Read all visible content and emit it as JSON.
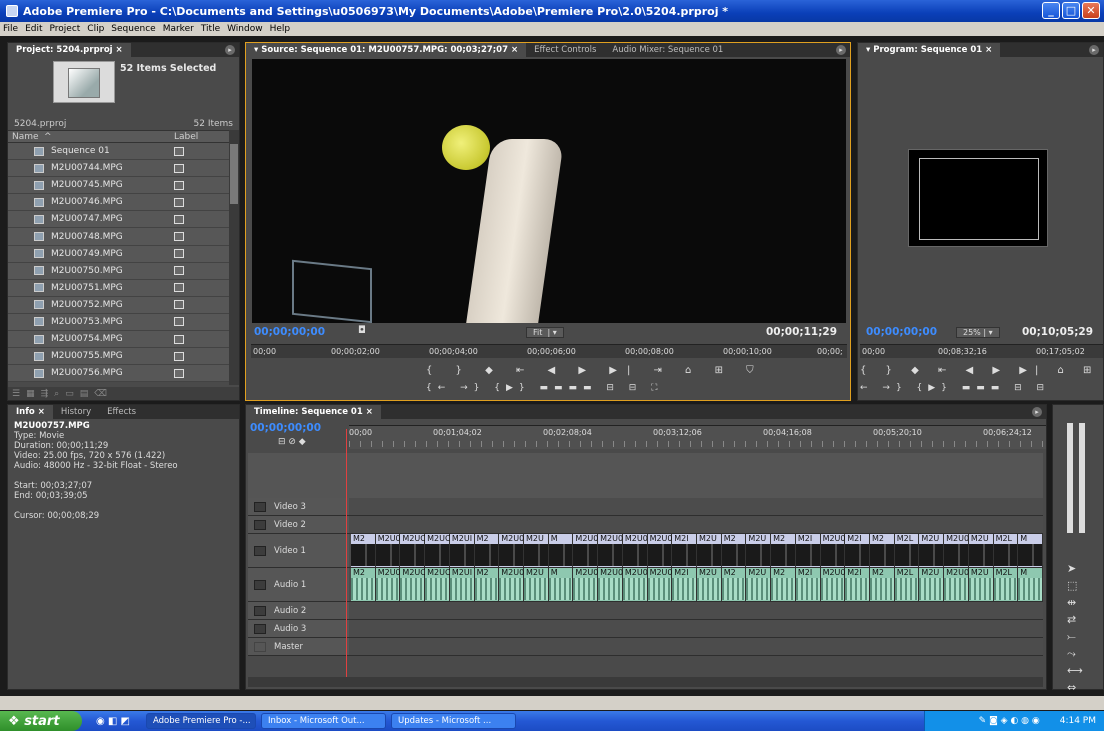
{
  "window": {
    "title": "Adobe Premiere Pro - C:\\Documents and Settings\\u0506973\\My Documents\\Adobe\\Premiere Pro\\2.0\\5204.prproj *"
  },
  "menu": [
    "File",
    "Edit",
    "Project",
    "Clip",
    "Sequence",
    "Marker",
    "Title",
    "Window",
    "Help"
  ],
  "project": {
    "tab": "Project: 5204.prproj",
    "selected": "52 Items Selected",
    "file": "5204.prproj",
    "count": "52 Items",
    "col_name": "Name",
    "col_label": "Label",
    "items": [
      "Sequence 01",
      "M2U00744.MPG",
      "M2U00745.MPG",
      "M2U00746.MPG",
      "M2U00747.MPG",
      "M2U00748.MPG",
      "M2U00749.MPG",
      "M2U00750.MPG",
      "M2U00751.MPG",
      "M2U00752.MPG",
      "M2U00753.MPG",
      "M2U00754.MPG",
      "M2U00755.MPG",
      "M2U00756.MPG"
    ]
  },
  "source": {
    "tabs": [
      "Source: Sequence 01: M2U00757.MPG: 00;03;27;07",
      "Effect Controls",
      "Audio Mixer: Sequence 01"
    ],
    "timecode": "00;00;00;00",
    "fit": "Fit",
    "duration": "00;00;11;29",
    "ruler": [
      "00;00",
      "00;00;02;00",
      "00;00;04;00",
      "00;00;06;00",
      "00;00;08;00",
      "00;00;10;00",
      "00;00;"
    ]
  },
  "program": {
    "tab": "Program: Sequence 01",
    "timecode": "00;00;00;00",
    "zoom": "25%",
    "duration": "00;10;05;29",
    "ruler": [
      "00;00",
      "00;08;32;16",
      "00;17;05;02"
    ]
  },
  "info": {
    "tabs": [
      "Info",
      "History",
      "Effects"
    ],
    "name": "M2U00757.MPG",
    "lines": [
      "Type: Movie",
      "Duration: 00;00;11;29",
      "Video: 25.00 fps, 720 x 576 (1.422)",
      "Audio: 48000 Hz - 32-bit Float - Stereo",
      "",
      "Start: 00;03;27;07",
      "End: 00;03;39;05",
      "",
      "Cursor: 00;00;08;29"
    ]
  },
  "timeline": {
    "tab": "Timeline: Sequence 01",
    "timecode": "00;00;00;00",
    "ruler": [
      "00;00",
      "00;01;04;02",
      "00;02;08;04",
      "00;03;12;06",
      "00;04;16;08",
      "00;05;20;10",
      "00;06;24;12"
    ],
    "tracks": [
      "Video 3",
      "Video 2",
      "Video 1",
      "Audio 1",
      "Audio 2",
      "Audio 3",
      "Master"
    ],
    "clip_labels": [
      "M2",
      "M2U0I",
      "M2UC",
      "M2UC",
      "M2UI",
      "M2",
      "M2U0",
      "M2U",
      "M",
      "M2U0075",
      "M2U0I",
      "M2U007",
      "M2U007",
      "M2I",
      "M2U",
      "M2",
      "M2U",
      "M2",
      "M2I",
      "M2U0",
      "M2I",
      "M2",
      "M2L",
      "M2U",
      "M2U0",
      "M2U",
      "M2L",
      "M"
    ]
  },
  "taskbar": {
    "start": "start",
    "tasks": [
      "Adobe Premiere Pro -...",
      "Inbox - Microsoft Out...",
      "Updates - Microsoft ..."
    ],
    "clock": "4:14 PM"
  }
}
